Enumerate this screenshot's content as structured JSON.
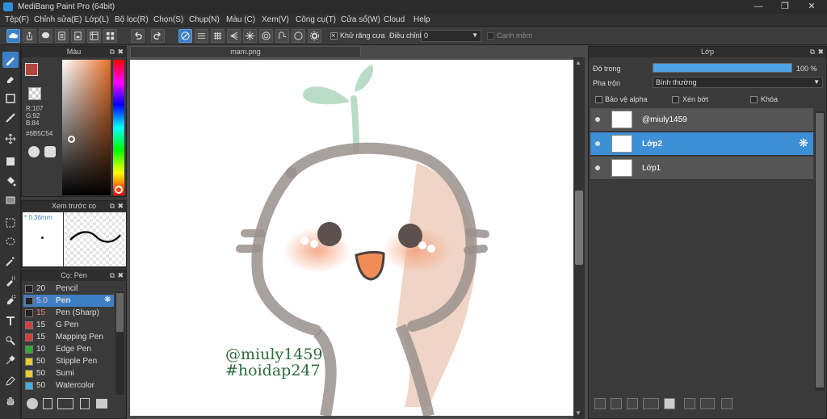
{
  "window": {
    "title": "MediBang Paint Pro (64bit)"
  },
  "menu": [
    "Tệp(F)",
    "Chỉnh sửa(E)",
    "Lớp(L)",
    "Bộ lọc(R)",
    "Chọn(S)",
    "Chụp(N)",
    "Màu (C)",
    "Xem(V)",
    "Công cụ(T)",
    "Cửa sổ(W)",
    "Cloud",
    "Help"
  ],
  "toolbar": {
    "antialias_label": "Khử răng cưa",
    "adjust_label": "Điều chỉnh",
    "adjust_value": "0",
    "edge_label": "Cạnh mềm"
  },
  "color_panel": {
    "title": "Màu",
    "r": "R:107",
    "g": "G:92",
    "b": "B:84",
    "hex": "#6B5C54"
  },
  "brush_preview": {
    "title": "Xem trước cọ",
    "size": "0.36mm"
  },
  "brush_panel": {
    "title": "Cọ: Pen",
    "items": [
      {
        "size": "20",
        "name": "Pencil",
        "color": "#222222"
      },
      {
        "size": "5.0",
        "name": "Pen",
        "color": "#222222"
      },
      {
        "size": "15",
        "name": "Pen (Sharp)",
        "color": "#222222"
      },
      {
        "size": "15",
        "name": "G Pen",
        "color": "#e03a3a"
      },
      {
        "size": "15",
        "name": "Mapping Pen",
        "color": "#e03a3a"
      },
      {
        "size": "10",
        "name": "Edge Pen",
        "color": "#2bb02b"
      },
      {
        "size": "50",
        "name": "Stipple Pen",
        "color": "#e8d020"
      },
      {
        "size": "50",
        "name": "Sumi",
        "color": "#e8d020"
      },
      {
        "size": "50",
        "name": "Watercolor",
        "color": "#3cb0e8"
      }
    ]
  },
  "document": {
    "tab": "mam.png"
  },
  "artwork": {
    "line1": "@miuly1459",
    "line2": "#hoidap247"
  },
  "layer_panel": {
    "title": "Lớp",
    "opacity_label": "Độ trong",
    "opacity_value": "100 %",
    "opacity_fraction": 1.0,
    "blend_label": "Pha trộn",
    "blend_value": "Bình thường",
    "protect_alpha": "Bảo vệ alpha",
    "clipping": "Xén bớt",
    "lock": "Khóa",
    "layers": [
      {
        "name": "@miuly1459",
        "selected": false
      },
      {
        "name": "Lớp2",
        "selected": true
      },
      {
        "name": "Lớp1",
        "selected": false
      }
    ]
  },
  "colors": {
    "accent": "#3d8fd6",
    "foreground": "#b0463c",
    "sprout": "#b9dcc6",
    "text_green": "#2f6b3f"
  }
}
